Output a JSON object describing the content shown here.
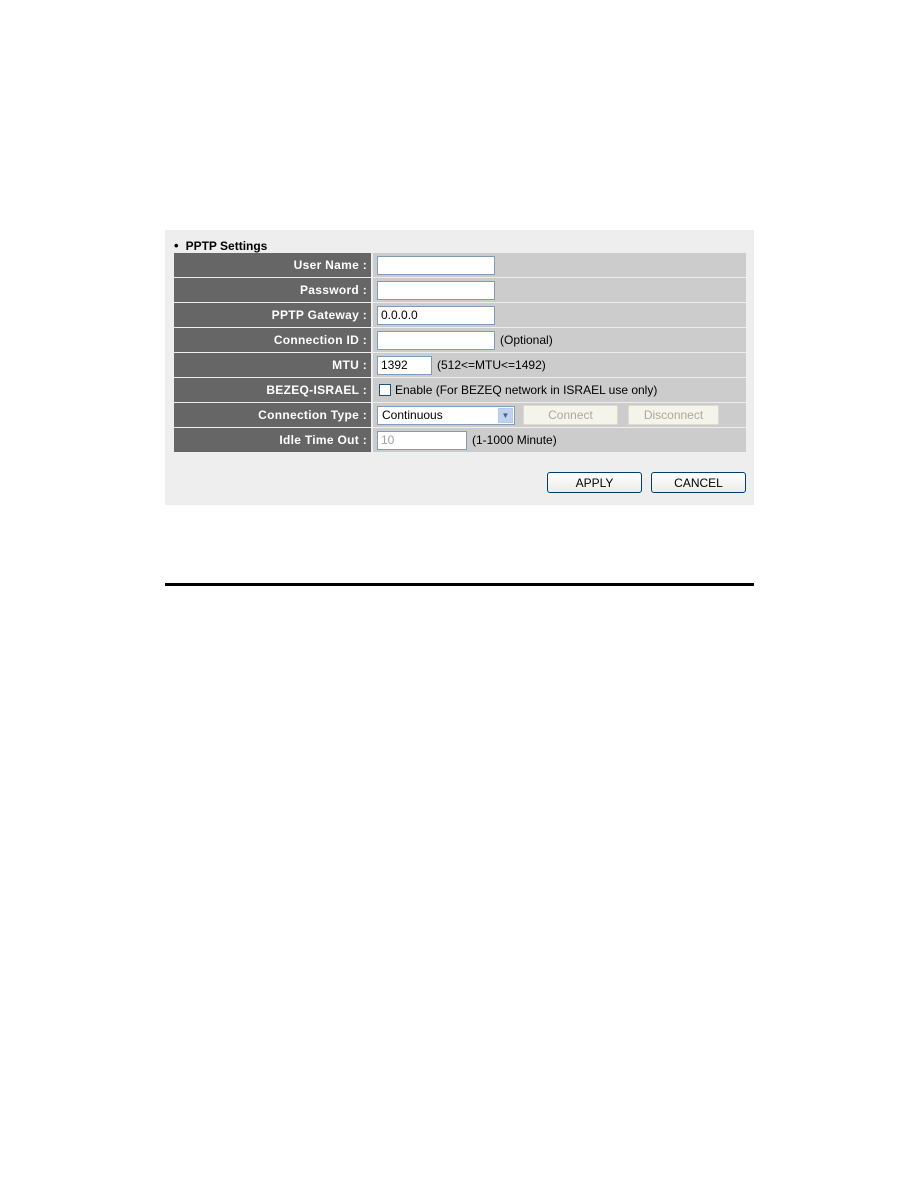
{
  "section": {
    "bullet": "•",
    "title": "PPTP Settings"
  },
  "fields": {
    "user_name": {
      "label": "User Name :",
      "value": ""
    },
    "password": {
      "label": "Password :",
      "value": ""
    },
    "pptp_gateway": {
      "label": "PPTP Gateway :",
      "value": "0.0.0.0"
    },
    "connection_id": {
      "label": "Connection ID :",
      "value": "",
      "hint": "(Optional)"
    },
    "mtu": {
      "label": "MTU :",
      "value": "1392",
      "hint": "(512<=MTU<=1492)"
    },
    "bezeq_israel": {
      "label": "BEZEQ-ISRAEL :",
      "checked": false,
      "checkbox_label": "Enable (For BEZEQ network in ISRAEL use only)"
    },
    "connection_type": {
      "label": "Connection Type :",
      "selected": "Continuous",
      "connect_label": "Connect",
      "disconnect_label": "Disconnect"
    },
    "idle_time_out": {
      "label": "Idle Time Out :",
      "value": "10",
      "hint": "(1-1000 Minute)"
    }
  },
  "buttons": {
    "apply": "APPLY",
    "cancel": "CANCEL"
  },
  "icons": {
    "dropdown_arrow": "▼"
  }
}
